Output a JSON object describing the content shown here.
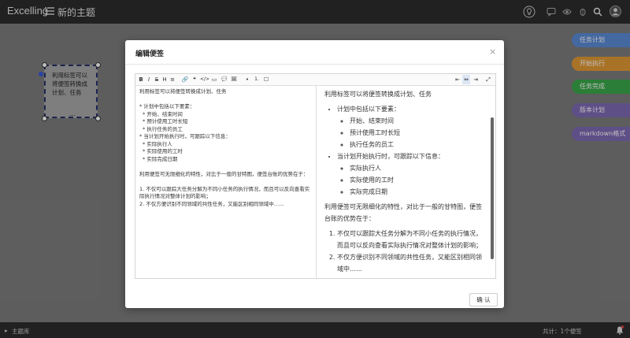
{
  "app": {
    "brand": "Excelling",
    "document_title": "新的主题"
  },
  "topbar_icons": [
    "lightbulb-icon",
    "chat-icon",
    "eye-icon",
    "bug-icon",
    "search-icon",
    "user-icon"
  ],
  "note": {
    "text": "利用标签可以将便签转换成计划、任务",
    "ellipsis": "...",
    "colors": {
      "border": "#25306c",
      "anchor": "#3a5bd9"
    }
  },
  "side_buttons": [
    {
      "label": "任务计划",
      "color": "#5b8bd6"
    },
    {
      "label": "开始执行",
      "color": "#e29a34"
    },
    {
      "label": "任务完成",
      "color": "#3aa84a"
    },
    {
      "label": "版本计划",
      "color": "#7e6ab5"
    },
    {
      "label": "markdown格式",
      "color": "#7e6ab5"
    }
  ],
  "footer": {
    "left": "主题库",
    "right": "共计：1个便签"
  },
  "modal": {
    "title": "编辑便签",
    "close": "×",
    "confirm": "确 认",
    "toolbar": [
      "B",
      "I",
      "S",
      "H",
      "≡",
      "🔗",
      "❝",
      "</>",
      "▭",
      "💬",
      "🖼",
      "•",
      "1.",
      "☐",
      "⇤",
      "⇔",
      "⇥",
      "⤢"
    ],
    "source_lines": [
      "利用标签可以将便签转换成计划、任务",
      "",
      "* 计划中包括以下要素：",
      "  * 开始、结束时间",
      "  * 预计使用工时长短",
      "  * 执行任务的员工",
      "* 当计划开始执行时，可跟踪以下信息：",
      "  * 实际执行人",
      "  * 实际使用的工时",
      "  * 实际完成日期",
      "",
      "利用便签可无限细化的特性，对比于一般的甘特图，便签台账的优势在于：",
      "",
      "1. 不仅可以跟踪大任务分解为不同小任务的执行情况，而且可以反向查看实际执行情况对整体计划的影响；",
      "2. 不仅方便识别不同领域的共性任务，又能区别相同领域中……"
    ],
    "preview": {
      "intro": "利用标签可以将便签转换成计划、任务",
      "list1": {
        "label": "计划中包括以下要素：",
        "items": [
          "开始、结束时间",
          "预计使用工时长短",
          "执行任务的员工"
        ]
      },
      "list2": {
        "label": "当计划开始执行时，可跟踪以下信息：",
        "items": [
          "实际执行人",
          "实际使用的工时",
          "实际完成日期"
        ]
      },
      "para": "利用便签可无限细化的特性，对比于一般的甘特图，便签台账的优势在于：",
      "ol": [
        "不仅可以跟踪大任务分解为不同小任务的执行情况，而且可以反向查看实际执行情况对整体计划的影响；",
        "不仅方便识别不同领域的共性任务，又能区别相同领域中……"
      ]
    }
  }
}
